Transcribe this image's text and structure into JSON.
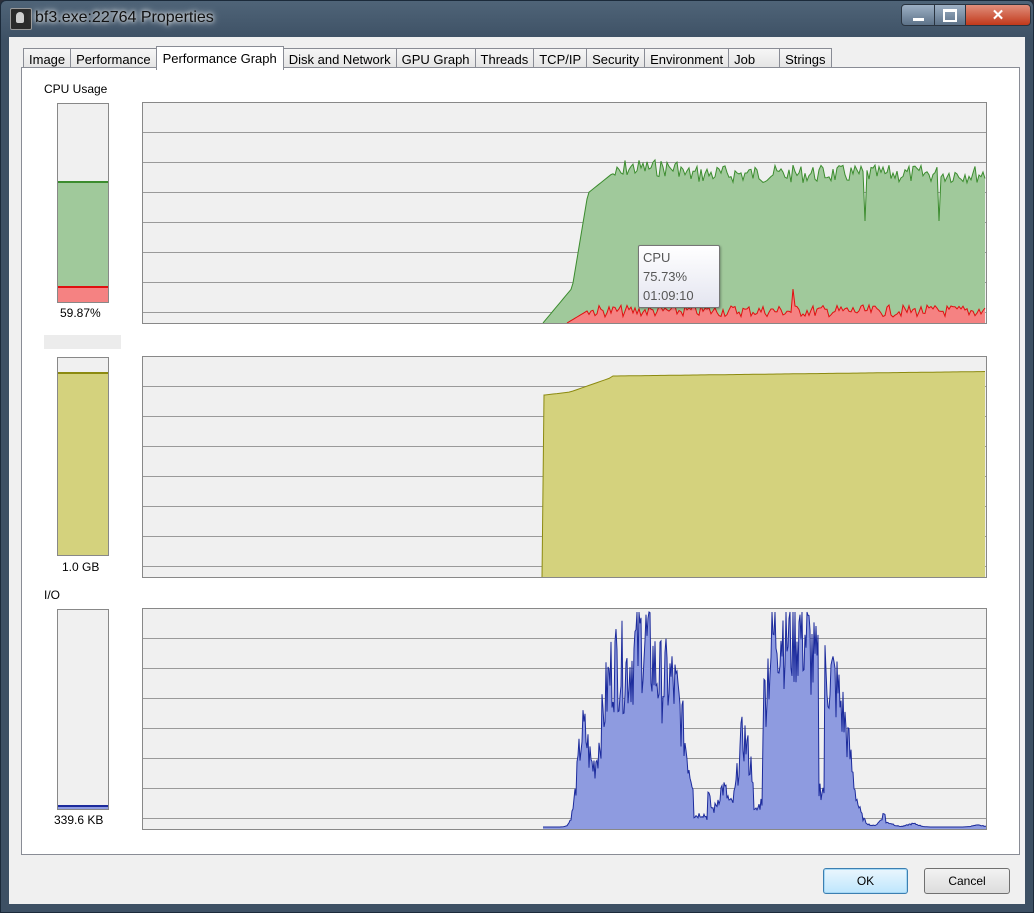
{
  "window": {
    "title": "bf3.exe:22764 Properties"
  },
  "tabs": [
    "Image",
    "Performance",
    "Performance Graph",
    "Disk and Network",
    "GPU Graph",
    "Threads",
    "TCP/IP",
    "Security",
    "Environment",
    "Job",
    "Strings"
  ],
  "active_tab": "Performance Graph",
  "cpu": {
    "label": "CPU Usage",
    "value_text": "59.87%",
    "meter_level": 0.5987,
    "kernel_level": 0.07,
    "fill_color": "#a0c99b",
    "line_color": "#3b8c2e",
    "kernel_fill": "#f58282",
    "kernel_line": "#e01010"
  },
  "memory": {
    "label": "",
    "value_text": "1.0 GB",
    "meter_level": 0.92,
    "fill_color": "#d4d27d",
    "line_color": "#8c8a10"
  },
  "io": {
    "label": "I/O",
    "value_text": "339.6  KB",
    "meter_level": 0.01,
    "fill_color": "#8e9be0",
    "line_color": "#1c2b9c"
  },
  "tooltip": {
    "line1": "CPU",
    "line2": "75.73%",
    "line3": "01:09:10"
  },
  "buttons": {
    "ok": "OK",
    "cancel": "Cancel"
  }
}
